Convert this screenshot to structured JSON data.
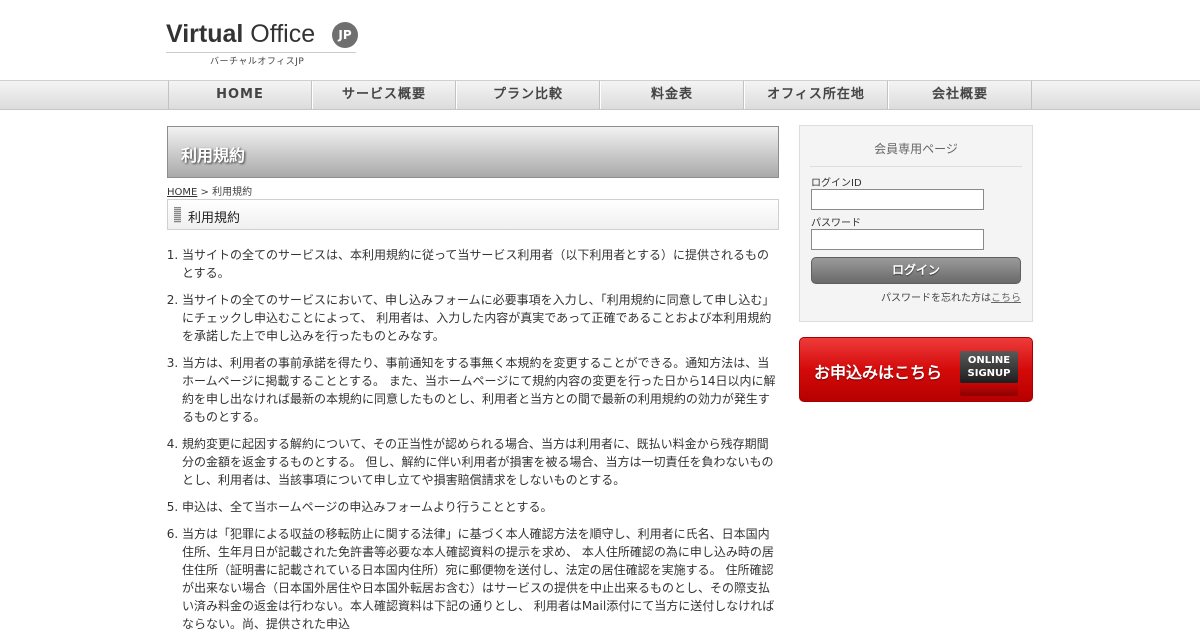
{
  "header": {
    "logo_bold": "Virtual",
    "logo_regular": "Office",
    "logo_badge": "JP",
    "logo_subtitle": "バーチャルオフィスJP"
  },
  "nav": {
    "items": [
      {
        "label": "HOME"
      },
      {
        "label": "サービス概要"
      },
      {
        "label": "プラン比較"
      },
      {
        "label": "料金表"
      },
      {
        "label": "オフィス所在地"
      },
      {
        "label": "会社概要"
      }
    ]
  },
  "page": {
    "title": "利用規約",
    "breadcrumb_home": "HOME",
    "breadcrumb_separator": " > ",
    "breadcrumb_current": "利用規約",
    "section_heading": "利用規約"
  },
  "terms": [
    "当サイトの全てのサービスは、本利用規約に従って当サービス利用者（以下利用者とする）に提供されるものとする。",
    "当サイトの全てのサービスにおいて、申し込みフォームに必要事項を入力し、「利用規約に同意して申し込む」にチェックし申込むことによって、 利用者は、入力した内容が真実であって正確であることおよび本利用規約を承諾した上で申し込みを行ったものとみなす。",
    "当方は、利用者の事前承諾を得たり、事前通知をする事無く本規約を変更することができる。通知方法は、当ホームページに掲載することとする。 また、当ホームページにて規約内容の変更を行った日から14日以内に解約を申し出なければ最新の本規約に同意したものとし、利用者と当方との間で最新の利用規約の効力が発生するものとする。",
    "規約変更に起因する解約について、その正当性が認められる場合、当方は利用者に、既払い料金から残存期間分の金額を返金するものとする。 但し、解約に伴い利用者が損害を被る場合、当方は一切責任を負わないものとし、利用者は、当該事項について申し立てや損害賠償請求をしないものとする。",
    "申込は、全て当ホームページの申込みフォームより行うこととする。",
    "当方は「犯罪による収益の移転防止に関する法律」に基づく本人確認方法を順守し、利用者に氏名、日本国内住所、生年月日が記載された免許書等必要な本人確認資料の提示を求め、 本人住所確認の為に申し込み時の居住住所（証明書に記載されている日本国内住所）宛に郵便物を送付し、法定の居住確認を実施する。 住所確認が出来ない場合（日本国外居住や日本国外転居お含む）はサービスの提供を中止出来るものとし、その際支払い済み料金の返金は行わない。本人確認資料は下記の通りとし、 利用者はMail添付にて当方に送付しなければならない。尚、提供された申込"
  ],
  "login": {
    "title": "会員専用ページ",
    "id_label": "ログインID",
    "id_value": "",
    "password_label": "パスワード",
    "password_value": "",
    "button_label": "ログイン",
    "forgot_text": "パスワードを忘れた方は",
    "forgot_link": "こちら"
  },
  "signup": {
    "label": "お申込みはこちら",
    "badge_line1": "ONLINE",
    "badge_line2": "SIGNUP"
  },
  "colors": {
    "signup_red": "#d40a0a",
    "nav_text": "#444444",
    "title_gradient_dark": "#a9a9a9"
  }
}
